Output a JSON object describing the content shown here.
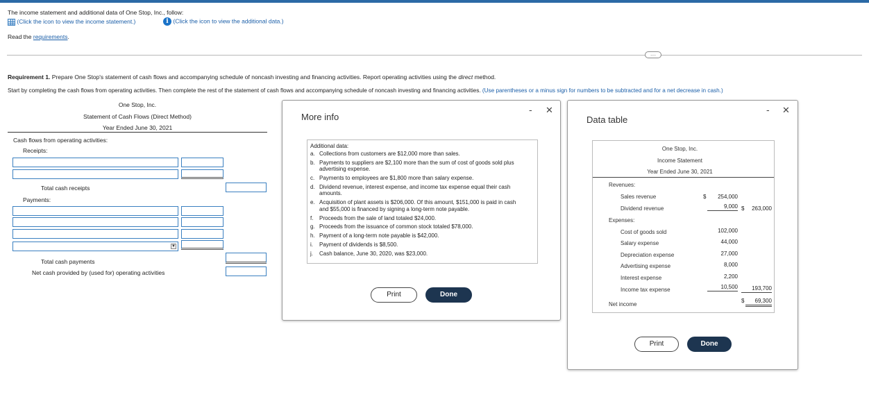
{
  "header": {
    "intro": "The income statement and additional data of One Stop, Inc., follow:",
    "income_link": "(Click the icon to view the income statement.)",
    "additional_link": "(Click the icon to view the additional data.)",
    "read_prefix": "Read the ",
    "requirements_link": "requirements",
    "read_suffix": "."
  },
  "requirement": {
    "label": "Requirement 1.",
    "text": " Prepare One Stop's statement of cash flows and accompanying schedule of noncash investing and financing activities. Report operating activities using the ",
    "method": "direct",
    "text_end": " method.",
    "instructions": "Start by completing the cash flows from operating activities. Then complete the rest of the statement of cash flows and accompanying schedule of noncash investing and financing activities.",
    "hint": "(Use parentheses or a minus sign for numbers to be subtracted and for a net decrease in cash.)"
  },
  "statement": {
    "company": "One Stop, Inc.",
    "title": "Statement of Cash Flows (Direct Method)",
    "period": "Year Ended June 30, 2021",
    "section": "Cash flows from operating activities:",
    "receipts": "Receipts:",
    "total_receipts": "Total cash receipts",
    "payments": "Payments:",
    "total_payments": "Total cash payments",
    "net_cash": "Net cash provided by (used for) operating activities"
  },
  "more_info": {
    "title": "More info",
    "heading": "Additional data:",
    "items": [
      {
        "letter": "a.",
        "lines": [
          "Collections from customers are $12,000 more than sales."
        ]
      },
      {
        "letter": "b.",
        "lines": [
          "Payments to suppliers are $2,100 more than the sum of cost of goods sold plus",
          "advertising expense."
        ]
      },
      {
        "letter": "c.",
        "lines": [
          "Payments to employees are $1,800 more than salary expense."
        ]
      },
      {
        "letter": "d.",
        "lines": [
          "Dividend revenue, interest expense, and income tax expense equal their cash",
          "amounts."
        ]
      },
      {
        "letter": "e.",
        "lines": [
          "Acquisition of plant assets is $206,000. Of this amount, $151,000 is paid in cash",
          "and $55,000 is financed by signing a long-term note payable."
        ]
      },
      {
        "letter": "f.",
        "lines": [
          "Proceeds from the sale of land totaled $24,000."
        ]
      },
      {
        "letter": "g.",
        "lines": [
          "Proceeds from the issuance of common stock totaled $78,000."
        ]
      },
      {
        "letter": "h.",
        "lines": [
          "Payment of a long-term note payable is $42,000."
        ]
      },
      {
        "letter": "i.",
        "lines": [
          "Payment of dividends is $8,500."
        ]
      },
      {
        "letter": "j.",
        "lines": [
          "Cash balance, June 30, 2020, was $23,000."
        ]
      }
    ],
    "print": "Print",
    "done": "Done"
  },
  "data_table": {
    "title": "Data table",
    "company": "One Stop, Inc.",
    "statement": "Income Statement",
    "period": "Year Ended June 30, 2021",
    "revenues_label": "Revenues:",
    "sales_label": "Sales revenue",
    "sales_dollar": "$",
    "sales_value": "254,000",
    "dividend_label": "Dividend revenue",
    "dividend_value": "9,000",
    "total_rev_dollar": "$",
    "total_rev_value": "263,000",
    "expenses_label": "Expenses:",
    "expenses": [
      {
        "label": "Cost of goods sold",
        "value": "102,000"
      },
      {
        "label": "Salary expense",
        "value": "44,000"
      },
      {
        "label": "Depreciation expense",
        "value": "27,000"
      },
      {
        "label": "Advertising expense",
        "value": "8,000"
      },
      {
        "label": "Interest expense",
        "value": "2,200"
      },
      {
        "label": "Income tax expense",
        "value": "10,500"
      }
    ],
    "total_exp_value": "193,700",
    "net_label": "Net income",
    "net_dollar": "$",
    "net_value": "69,300",
    "print": "Print",
    "done": "Done"
  },
  "window_controls": {
    "minimize": "-",
    "close": "✕"
  },
  "dots": "....",
  "select_arrow": "▼",
  "colors": {
    "accent": "#2b6aa6",
    "link": "#1a5ea8",
    "done_button": "#1d3550"
  }
}
